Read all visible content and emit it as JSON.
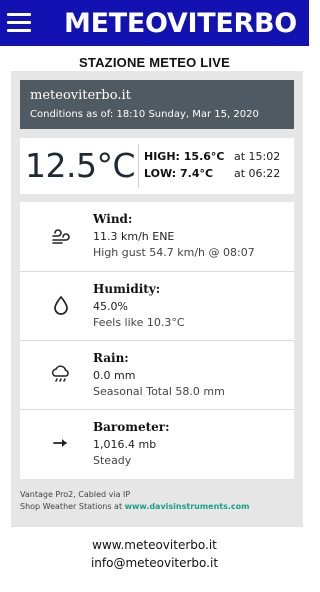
{
  "app": {
    "brand": "METEOVITERBO",
    "subtitle": "STAZIONE METEO LIVE"
  },
  "station": {
    "name": "meteoviterbo.it",
    "conditions": "Conditions as of: 18:10 Sunday, Mar 15, 2020"
  },
  "temperature": {
    "current": "12.5°C",
    "high_label": "HIGH: 15.6°C",
    "high_time": "at 15:02",
    "low_label": "LOW: 7.4°C",
    "low_time": "at 06:22"
  },
  "metrics": [
    {
      "title": "Wind:",
      "line1": "11.3 km/h ENE",
      "line2": "High gust 54.7 km/h @ 08:07",
      "icon": "wind-icon"
    },
    {
      "title": "Humidity:",
      "line1": "45.0%",
      "line2": "Feels like 10.3°C",
      "icon": "droplet-icon"
    },
    {
      "title": "Rain:",
      "line1": "0.0 mm",
      "line2": "Seasonal Total 58.0 mm",
      "icon": "rain-cloud-icon"
    },
    {
      "title": "Barometer:",
      "line1": "1,016.4 mb",
      "line2": "Steady",
      "icon": "arrow-right-icon"
    }
  ],
  "footer": {
    "device": "Vantage Pro2, Cabled via IP",
    "shop_text": "Shop Weather Stations at ",
    "shop_link": "www.davisinstruments.com"
  },
  "contacts": {
    "website": "www.meteoviterbo.it",
    "email": "info@meteoviterbo.it"
  },
  "colors": {
    "topbar": "#1212b3",
    "header_box": "#505a62",
    "link": "#16a085"
  }
}
